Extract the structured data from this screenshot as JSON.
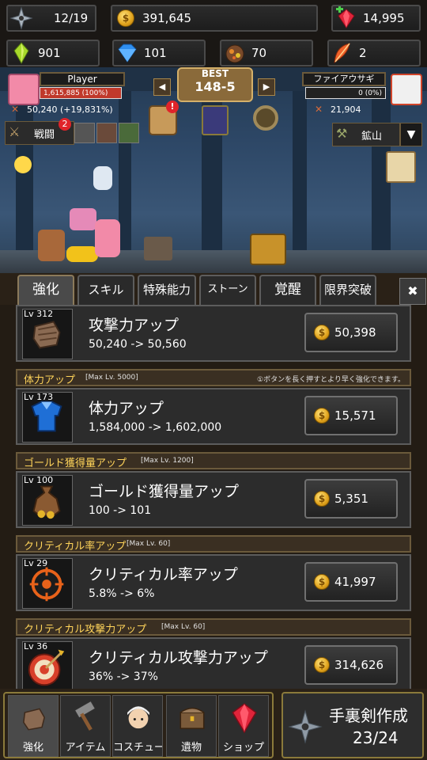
{
  "resources": {
    "shuriken": "12/19",
    "gold": "391,645",
    "gems": "14,995",
    "green_crystal": "901",
    "diamond": "101",
    "ore": "70",
    "feather": "2"
  },
  "player": {
    "name": "Player",
    "hp": "1,615,885 (100%)",
    "attack": "50,240 (+19,831%)"
  },
  "stage": {
    "best_label": "BEST",
    "value": "148-5"
  },
  "enemy": {
    "name": "ファイアウサギ",
    "hp": "0 (0%)",
    "attack": "21,904"
  },
  "battle": {
    "label": "戦闘",
    "badge": "2"
  },
  "mine": {
    "label": "鉱山",
    "chevron": "▼"
  },
  "tabs": [
    "強化",
    "スキル",
    "特殊能力",
    "ストーン",
    "覚醒",
    "限界突破"
  ],
  "close": "✖",
  "sections": [
    {
      "name": "体力アップ",
      "max": "[Max Lv. 5000]",
      "hint": "①ボタンを長く押すとより早く強化できます。"
    },
    {
      "name": "ゴールド獲得量アップ",
      "max": "[Max Lv. 1200]"
    },
    {
      "name": "クリティカル率アップ",
      "max": "[Max Lv. 60]"
    },
    {
      "name": "クリティカル攻撃力アップ",
      "max": "[Max Lv. 60]"
    }
  ],
  "upgrades": [
    {
      "level": "Lv 312",
      "title": "攻撃力アップ",
      "stat": "50,240 -> 50,560",
      "cost": "50,398",
      "icon": "fist-icon"
    },
    {
      "level": "Lv 173",
      "title": "体力アップ",
      "stat": "1,584,000 -> 1,602,000",
      "cost": "15,571",
      "icon": "armor-icon"
    },
    {
      "level": "Lv 100",
      "title": "ゴールド獲得量アップ",
      "stat": "100 -> 101",
      "cost": "5,351",
      "icon": "gold-bag-icon"
    },
    {
      "level": "Lv 29",
      "title": "クリティカル率アップ",
      "stat": "5.8% -> 6%",
      "cost": "41,997",
      "icon": "crosshair-icon"
    },
    {
      "level": "Lv 36",
      "title": "クリティカル攻撃力アップ",
      "stat": "36% -> 37%",
      "cost": "314,626",
      "icon": "target-icon"
    }
  ],
  "nav": [
    "強化",
    "アイテム",
    "コスチューム",
    "遺物",
    "ショップ"
  ],
  "craft": {
    "title": "手裏剣作成",
    "count": "23/24"
  },
  "coin_symbol": "$"
}
